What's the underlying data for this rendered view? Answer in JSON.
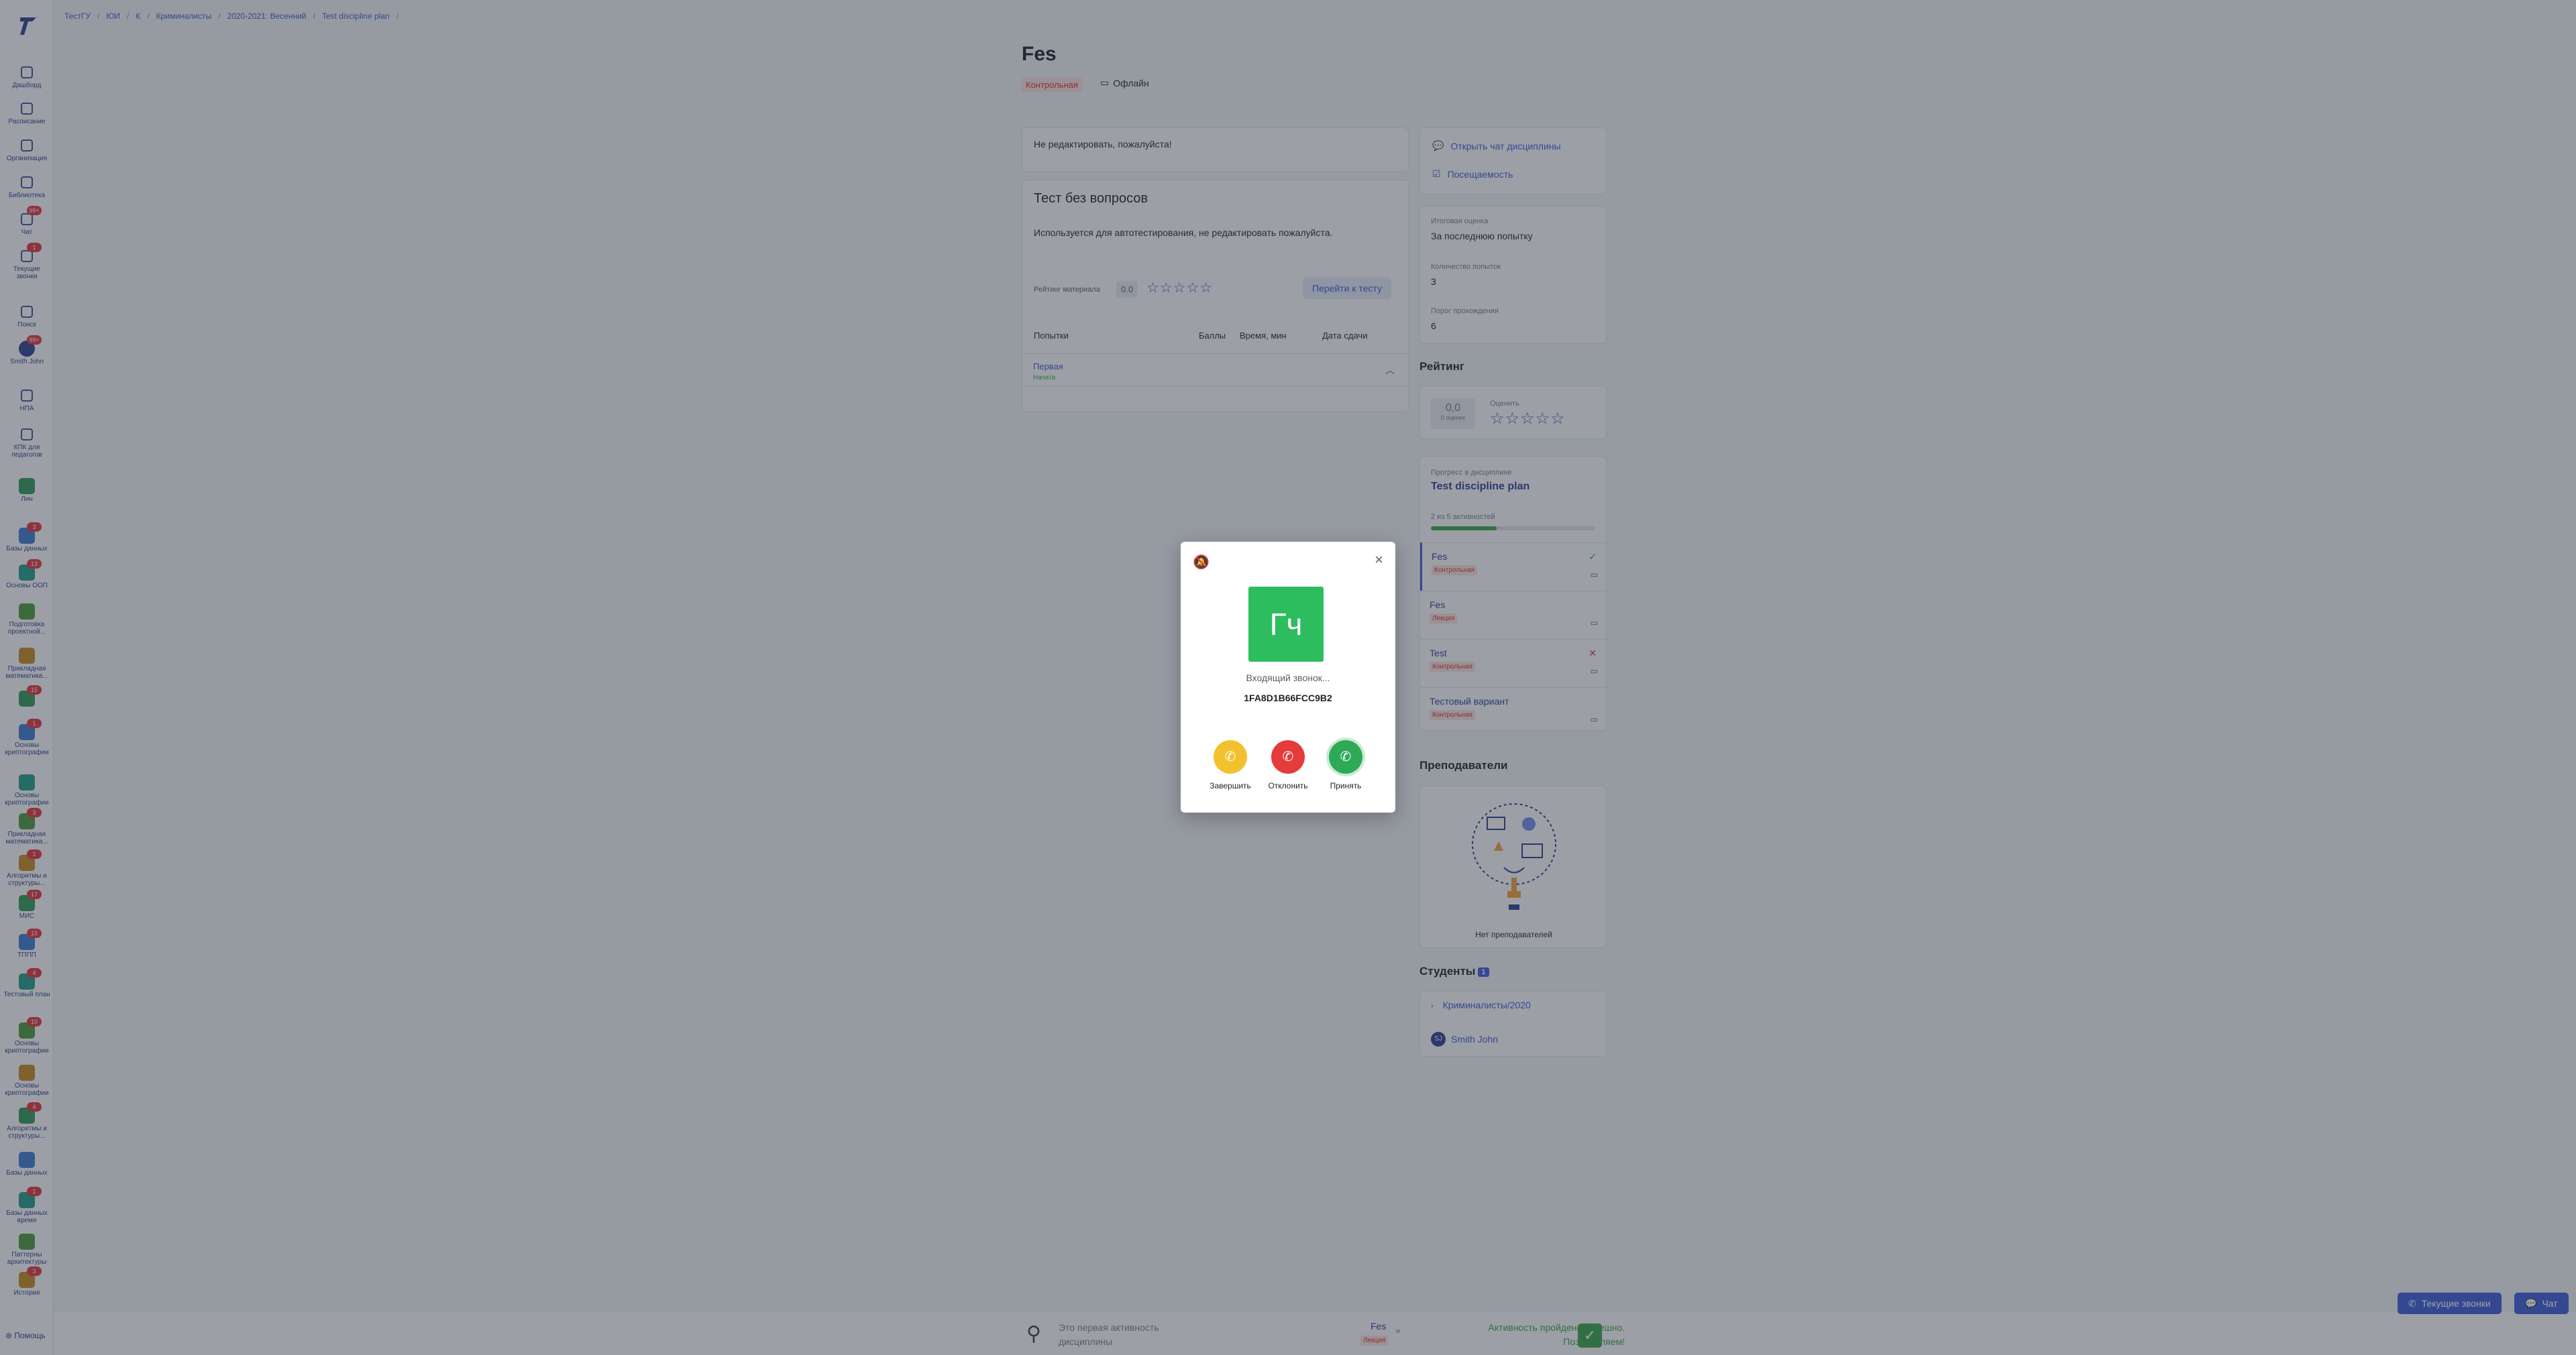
{
  "breadcrumb": [
    "ТестГУ",
    "ЮИ",
    "К",
    "Криминалисты",
    "2020-2021: Весенний",
    "Test discipline plan"
  ],
  "sidebar": {
    "items": [
      {
        "label": "Дашборд",
        "icon": "dashboard-icon"
      },
      {
        "label": "Расписание",
        "icon": "calendar-icon"
      },
      {
        "label": "Организация",
        "icon": "building-icon"
      },
      {
        "label": "Библиотека",
        "icon": "book-icon"
      },
      {
        "label": "Чат",
        "icon": "chat-icon",
        "badge": "99+"
      },
      {
        "label": "Текущие звонки",
        "icon": "phone-icon",
        "badge": "1"
      },
      {
        "label": "Поиск",
        "icon": "search-icon"
      },
      {
        "label": "Smith John",
        "icon": "avatar",
        "badge": "99+"
      },
      {
        "label": "НПА",
        "icon": "npa-icon"
      },
      {
        "label": "КПК для педагогов",
        "icon": "kpk-icon"
      },
      {
        "label": "Лин",
        "icon": "course-avatar"
      },
      {
        "label": "Базы данных",
        "icon": "course-avatar",
        "badge": "3"
      },
      {
        "label": "Основы ООП",
        "icon": "course-avatar",
        "badge": "13"
      },
      {
        "label": "Подготовка проектной...",
        "icon": "course-avatar"
      },
      {
        "label": "Прикладная математика...",
        "icon": "course-avatar"
      },
      {
        "label": "",
        "icon": "course-avatar",
        "badge": "15"
      },
      {
        "label": "Основы криптографии",
        "icon": "course-avatar",
        "badge": "1"
      },
      {
        "label": "Основы криптографии",
        "icon": "course-avatar"
      },
      {
        "label": "Прикладная математика...",
        "icon": "course-avatar",
        "badge": "3"
      },
      {
        "label": "Алгоритмы и структуры...",
        "icon": "course-avatar",
        "badge": "1"
      },
      {
        "label": "МИС",
        "icon": "course-avatar",
        "badge": "17"
      },
      {
        "label": "ТППП",
        "icon": "course-avatar",
        "badge": "15"
      },
      {
        "label": "Тестовый план",
        "icon": "course-avatar",
        "badge": "4"
      },
      {
        "label": "Основы криптографии",
        "icon": "course-avatar",
        "badge": "10"
      },
      {
        "label": "Основы криптографии",
        "icon": "course-avatar"
      },
      {
        "label": "Алгоритмы и структуры...",
        "icon": "course-avatar",
        "badge": "4"
      },
      {
        "label": "Базы данных",
        "icon": "course-avatar"
      },
      {
        "label": "Базы данных время",
        "icon": "course-avatar",
        "badge": "1"
      },
      {
        "label": "Паттерны архитектуры",
        "icon": "course-avatar"
      },
      {
        "label": "История",
        "icon": "course-avatar",
        "badge": "3"
      }
    ],
    "help": "Помощь"
  },
  "main": {
    "title": "Fes",
    "type_badge": "Контрольная",
    "offline": "Офлайн",
    "notice": "Не редактировать, пожалуйста!",
    "test": {
      "title": "Тест без вопросов",
      "description": "Используется для автотестирования, не редактировать пожалуйста.",
      "rating_label": "Рейтинг материала",
      "rating_value": "0.0",
      "stars": "☆☆☆☆☆",
      "go_button": "Перейти к тесту",
      "columns": [
        "Попытки",
        "Баллы",
        "Время, мин",
        "Дата сдачи"
      ],
      "attempt": {
        "name": "Первая",
        "status": "Начата"
      }
    }
  },
  "right": {
    "links": [
      "Открыть чат дисциплины",
      "Посещаемость"
    ],
    "stats": [
      {
        "label": "Итоговая оценка",
        "value": "За последнюю попытку"
      },
      {
        "label": "Количество попыток",
        "value": "3"
      },
      {
        "label": "Порог прохождения",
        "value": "6"
      }
    ],
    "rating": {
      "title": "Рейтинг",
      "value": "0,0",
      "count": "0 оценок",
      "my_label": "Оценить",
      "stars": "☆☆☆☆☆"
    },
    "progress": {
      "label": "Прогресс в дисциплине",
      "title": "Test discipline plan",
      "count": "2 из 5 активностей",
      "fraction": 0.4,
      "activities": [
        {
          "name": "Fes",
          "type": "Контрольная",
          "mark": "✓",
          "mark_color": "#37a649",
          "current": true
        },
        {
          "name": "Fes",
          "type": "Лекция",
          "mark": "",
          "mark_color": "#5a6068",
          "current": false
        },
        {
          "name": "Test",
          "type": "Контрольная",
          "mark": "✕",
          "mark_color": "#e5343d",
          "current": false
        },
        {
          "name": "Тестовый вариант",
          "type": "Контрольная",
          "mark": "",
          "mark_color": "#5a6068",
          "current": false
        }
      ]
    },
    "teachers": {
      "title": "Преподаватели",
      "empty": "Нет преподавателей"
    },
    "students": {
      "title": "Студенты",
      "count": "1",
      "group": "Криминалисты/2020",
      "student": "Smith John",
      "student_initials": "SJ"
    }
  },
  "bottom_bar": {
    "first": "Это первая активность дисциплины",
    "act_name": "Fes",
    "act_type": "Лекция",
    "next": "»",
    "done": "Активность пройдена успешно. Поздравляем!",
    "check": "✓"
  },
  "floating": {
    "calls": "Текущие звонки",
    "chat": "Чат"
  },
  "call_modal": {
    "avatar_text": "Гч",
    "incoming": "Входящий звонок...",
    "caller_id": "1FA8D1B66FCC9B2",
    "end": "Завершить",
    "decline": "Отклонить",
    "accept": "Принять"
  },
  "colors": {
    "accent": "#3b5bdb",
    "success": "#37a649",
    "danger": "#e5343d",
    "warning": "#f2c12e"
  }
}
